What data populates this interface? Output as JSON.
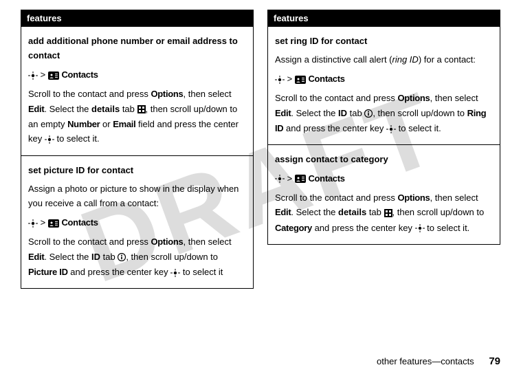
{
  "watermark": "DRAFT",
  "header": "features",
  "left": {
    "cell1": {
      "title": "add additional phone number or email address to contact",
      "nav_contacts": "Contacts",
      "t1": "Scroll to the contact and press ",
      "options": "Options",
      "t2": ", then select ",
      "edit": "Edit",
      "t3": ". Select the ",
      "details": "details",
      "t4": " tab ",
      "t5": ", then scroll up/down to an empty ",
      "number": "Number",
      "t6": " or ",
      "email": "Email",
      "t7": " field and press the center key ",
      "t8": " to select it."
    },
    "cell2": {
      "title": "set picture ID for contact",
      "desc": "Assign a photo or picture to show in the display when you receive a call from a contact:",
      "nav_contacts": "Contacts",
      "t1": "Scroll to the contact and press ",
      "options": "Options",
      "t2": ", then select ",
      "edit": "Edit",
      "t3": ". Select the ",
      "idtab": "ID",
      "t4": " tab ",
      "t5": ", then scroll up/down to ",
      "pictureid": "Picture ID",
      "t6": " and press the center key ",
      "t7": " to select it"
    }
  },
  "right": {
    "cell1": {
      "title": "set ring ID for contact",
      "desc1": "Assign a distinctive call alert (",
      "ringid_i": "ring ID",
      "desc2": ") for a contact:",
      "nav_contacts": "Contacts",
      "t1": "Scroll to the contact and press ",
      "options": "Options",
      "t2": ", then select ",
      "edit": "Edit",
      "t3": ". Select the ",
      "idtab": "ID",
      "t4": " tab ",
      "t5": ", then scroll up/down to ",
      "ringid": "Ring ID",
      "t6": " and press the center key ",
      "t7": " to select it."
    },
    "cell2": {
      "title": "assign contact to category",
      "nav_contacts": "Contacts",
      "t1": "Scroll to the contact and press ",
      "options": "Options",
      "t2": ", then select ",
      "edit": "Edit",
      "t3": ". Select the ",
      "details": "details",
      "t4": " tab ",
      "t5": ", then scroll up/down to ",
      "category": "Category",
      "t6": " and press the center key ",
      "t7": " to select it."
    }
  },
  "footer": {
    "text": "other features—contacts",
    "page": "79"
  }
}
